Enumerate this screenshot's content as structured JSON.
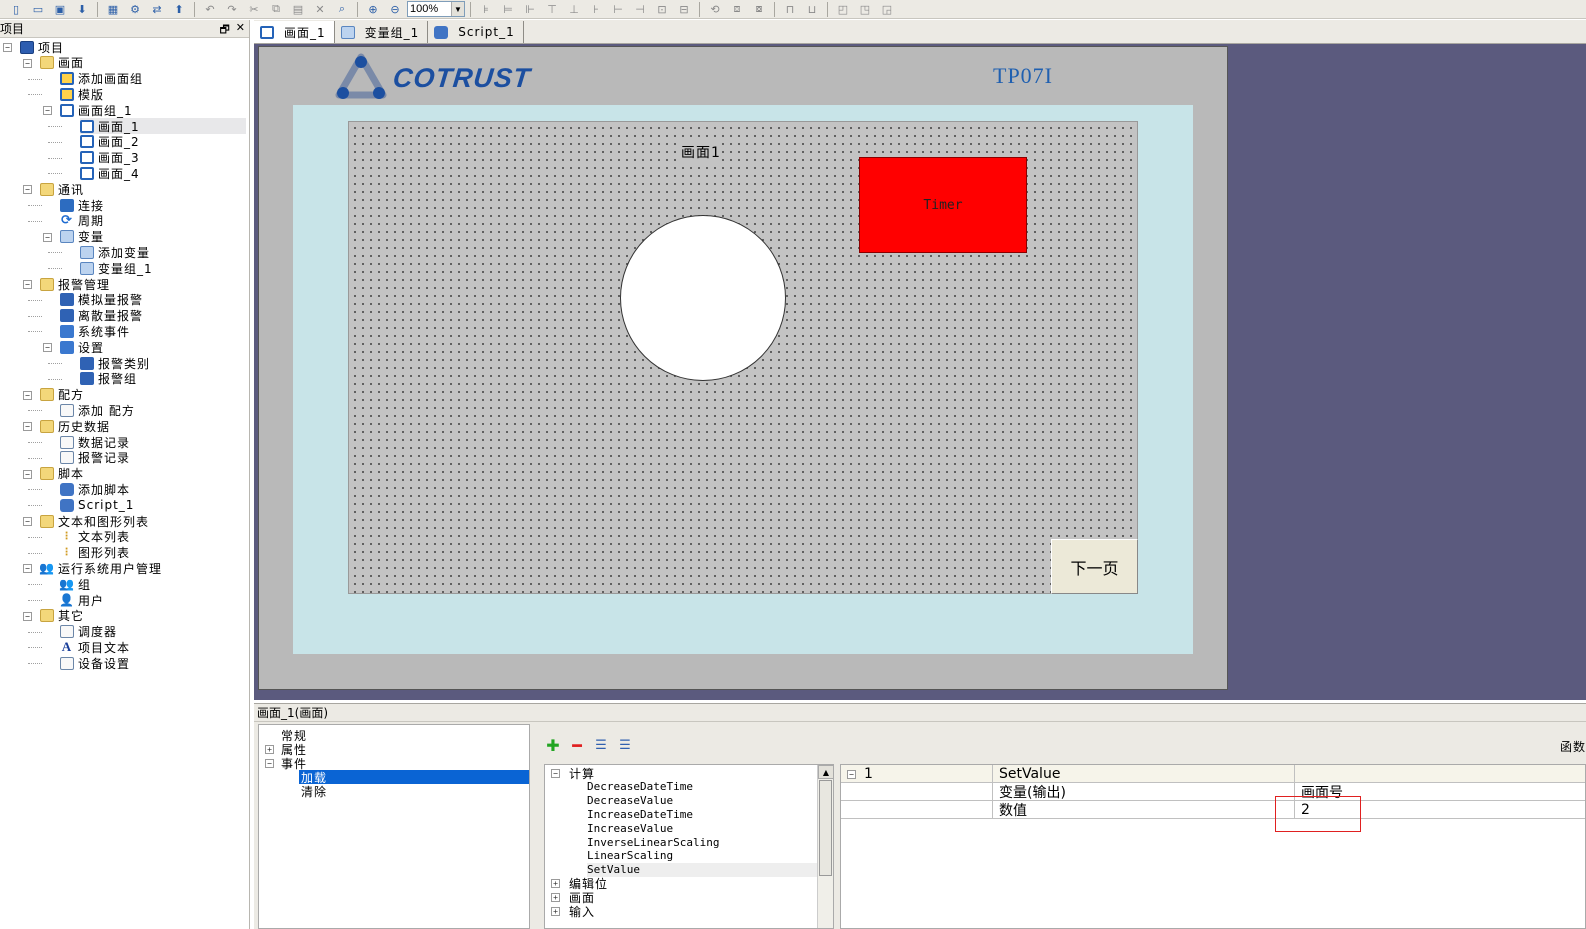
{
  "toolbar": {
    "zoom_value": "100%",
    "icons": [
      "new-icon",
      "open-icon",
      "save-icon",
      "download-icon",
      "screen-icon",
      "settings-icon",
      "transfer-icon",
      "upload-icon",
      "undo-icon",
      "redo-icon",
      "cut-icon",
      "copy-icon",
      "paste-icon",
      "delete-icon",
      "find-icon",
      "zoom-in-icon",
      "zoom-out-icon"
    ]
  },
  "project_panel": {
    "header": "项目",
    "header_buttons": [
      "🗗",
      "✕"
    ],
    "items": [
      {
        "label": "项目",
        "level": 0,
        "icon": "project-icon",
        "expander": "−"
      },
      {
        "label": "画面",
        "level": 1,
        "icon": "folder-icon",
        "expander": "−"
      },
      {
        "label": "添加画面组",
        "level": 2,
        "icon": "add-screen-group-icon"
      },
      {
        "label": "模版",
        "level": 2,
        "icon": "template-icon"
      },
      {
        "label": "画面组_1",
        "level": 2,
        "icon": "screen-group-icon",
        "expander": "−"
      },
      {
        "label": "画面_1",
        "level": 3,
        "icon": "screen-icon",
        "selected": true
      },
      {
        "label": "画面_2",
        "level": 3,
        "icon": "screen-icon"
      },
      {
        "label": "画面_3",
        "level": 3,
        "icon": "screen-icon"
      },
      {
        "label": "画面_4",
        "level": 3,
        "icon": "screen-icon"
      },
      {
        "label": "通讯",
        "level": 1,
        "icon": "folder-icon",
        "expander": "−"
      },
      {
        "label": "连接",
        "level": 2,
        "icon": "connection-icon"
      },
      {
        "label": "周期",
        "level": 2,
        "icon": "cycle-icon"
      },
      {
        "label": "变量",
        "level": 2,
        "icon": "variable-icon",
        "expander": "−"
      },
      {
        "label": "添加变量",
        "level": 3,
        "icon": "add-variable-icon"
      },
      {
        "label": "变量组_1",
        "level": 3,
        "icon": "variable-group-icon"
      },
      {
        "label": "报警管理",
        "level": 1,
        "icon": "alarm-folder-icon",
        "expander": "−"
      },
      {
        "label": "模拟量报警",
        "level": 2,
        "icon": "analog-alarm-icon"
      },
      {
        "label": "离散量报警",
        "level": 2,
        "icon": "discrete-alarm-icon"
      },
      {
        "label": "系统事件",
        "level": 2,
        "icon": "system-event-icon"
      },
      {
        "label": "设置",
        "level": 2,
        "icon": "settings-icon",
        "expander": "−"
      },
      {
        "label": "报警类别",
        "level": 3,
        "icon": "alarm-class-icon"
      },
      {
        "label": "报警组",
        "level": 3,
        "icon": "alarm-group-icon"
      },
      {
        "label": "配方",
        "level": 1,
        "icon": "folder-icon",
        "expander": "−"
      },
      {
        "label": "添加 配方",
        "level": 2,
        "icon": "add-recipe-icon"
      },
      {
        "label": "历史数据",
        "level": 1,
        "icon": "folder-icon",
        "expander": "−"
      },
      {
        "label": "数据记录",
        "level": 2,
        "icon": "data-log-icon"
      },
      {
        "label": "报警记录",
        "level": 2,
        "icon": "alarm-log-icon"
      },
      {
        "label": "脚本",
        "level": 1,
        "icon": "script-folder-icon",
        "expander": "−"
      },
      {
        "label": "添加脚本",
        "level": 2,
        "icon": "add-script-icon"
      },
      {
        "label": "Script_1",
        "level": 2,
        "icon": "script-icon"
      },
      {
        "label": "文本和图形列表",
        "level": 1,
        "icon": "folder-icon",
        "expander": "−"
      },
      {
        "label": "文本列表",
        "level": 2,
        "icon": "text-list-icon"
      },
      {
        "label": "图形列表",
        "level": 2,
        "icon": "graphic-list-icon"
      },
      {
        "label": "运行系统用户管理",
        "level": 1,
        "icon": "user-admin-icon",
        "expander": "−"
      },
      {
        "label": "组",
        "level": 2,
        "icon": "group-icon"
      },
      {
        "label": "用户",
        "level": 2,
        "icon": "user-icon"
      },
      {
        "label": "其它",
        "level": 1,
        "icon": "folder-icon",
        "expander": "−"
      },
      {
        "label": "调度器",
        "level": 2,
        "icon": "scheduler-icon"
      },
      {
        "label": "项目文本",
        "level": 2,
        "icon": "project-text-icon"
      },
      {
        "label": "设备设置",
        "level": 2,
        "icon": "device-settings-icon"
      }
    ]
  },
  "tabs": [
    {
      "label": "画面_1",
      "icon": "screen-icon",
      "active": true
    },
    {
      "label": "变量组_1",
      "icon": "variable-group-icon"
    },
    {
      "label": "Script_1",
      "icon": "script-icon"
    }
  ],
  "canvas": {
    "logo_text": "COTRUST",
    "model": "TP07I",
    "screen_title": "画面1",
    "timer_label": "Timer",
    "next_button": "下一页",
    "colors": {
      "timer_fill": "#ff0000",
      "bezel": "#c8e4e8",
      "frame": "#b9b9b9",
      "workspace": "#5b5a7e"
    }
  },
  "properties": {
    "title": "画面_1(画面)",
    "categories": [
      {
        "label": "常规",
        "expander": ""
      },
      {
        "label": "属性",
        "expander": "+"
      },
      {
        "label": "事件",
        "expander": "−"
      },
      {
        "label": "加载",
        "child": true,
        "selected": true
      },
      {
        "label": "清除",
        "child": true
      }
    ],
    "func_toolbar": {
      "add": "✚",
      "remove": "━",
      "indent": "☰",
      "outdent": "☰"
    },
    "right_label": "函数",
    "functions": [
      {
        "label": "计算",
        "group": true,
        "expander": "−"
      },
      {
        "label": "DecreaseDateTime"
      },
      {
        "label": "DecreaseValue"
      },
      {
        "label": "IncreaseDateTime"
      },
      {
        "label": "IncreaseValue"
      },
      {
        "label": "InverseLinearScaling"
      },
      {
        "label": "LinearScaling"
      },
      {
        "label": "SetValue",
        "selected": true
      },
      {
        "label": "编辑位",
        "group": true,
        "expander": "+"
      },
      {
        "label": "画面",
        "group": true,
        "expander": "+"
      },
      {
        "label": "输入",
        "group": true,
        "expander": "+"
      }
    ],
    "params": {
      "header": {
        "index": "1",
        "expander": "−",
        "name": "SetValue",
        "value": ""
      },
      "rows": [
        {
          "name": "变量(输出)",
          "value": "画面号"
        },
        {
          "name": "数值",
          "value": "2"
        }
      ]
    }
  }
}
